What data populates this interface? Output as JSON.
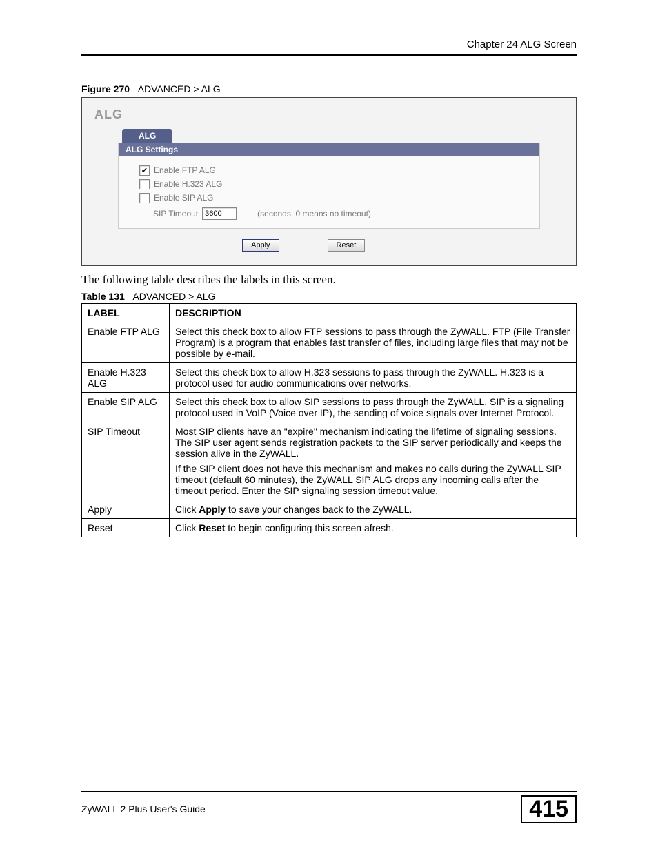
{
  "header": {
    "chapter": "Chapter 24 ALG Screen"
  },
  "figure": {
    "label": "Figure 270",
    "title": "ADVANCED > ALG",
    "panel_title": "ALG",
    "tab": "ALG",
    "settings_header": "ALG Settings",
    "chk": {
      "ftp": "Enable FTP ALG",
      "h323": "Enable H.323 ALG",
      "sip": "Enable SIP ALG"
    },
    "timeout_label": "SIP Timeout",
    "timeout_value": "3600",
    "timeout_hint": "(seconds, 0 means no timeout)",
    "buttons": {
      "apply": "Apply",
      "reset": "Reset"
    }
  },
  "intro": "The following table describes the labels in this screen.",
  "table": {
    "label": "Table 131",
    "title": "ADVANCED > ALG",
    "headers": {
      "label": "LABEL",
      "desc": "DESCRIPTION"
    },
    "rows": [
      {
        "label": "Enable FTP ALG",
        "desc": "Select this check box to allow FTP sessions to pass through the ZyWALL. FTP (File Transfer Program) is a program that enables fast transfer of files, including large files that may not be possible by e-mail."
      },
      {
        "label": "Enable H.323 ALG",
        "desc": "Select this check box to allow H.323 sessions to pass through the ZyWALL. H.323 is a protocol used for audio communications over networks."
      },
      {
        "label": "Enable SIP ALG",
        "desc": "Select this check box to allow SIP sessions to pass through the ZyWALL. SIP is a signaling protocol used in VoIP (Voice over IP), the sending of voice signals over Internet Protocol."
      },
      {
        "label": "SIP Timeout",
        "desc_p1": "Most SIP clients have an \"expire\" mechanism indicating the lifetime of signaling sessions. The SIP user agent sends registration packets to the SIP server periodically and keeps the session alive in the ZyWALL.",
        "desc_p2": "If the SIP client does not have this mechanism and makes no calls during the ZyWALL SIP timeout (default 60 minutes), the ZyWALL SIP ALG drops any incoming calls after the timeout period. Enter the SIP signaling session timeout value."
      },
      {
        "label": "Apply",
        "desc_pre": "Click ",
        "desc_bold": "Apply",
        "desc_post": " to save your changes back to the ZyWALL."
      },
      {
        "label": "Reset",
        "desc_pre": "Click ",
        "desc_bold": "Reset",
        "desc_post": " to begin configuring this screen afresh."
      }
    ]
  },
  "footer": {
    "guide": "ZyWALL 2 Plus User's Guide",
    "page": "415"
  }
}
